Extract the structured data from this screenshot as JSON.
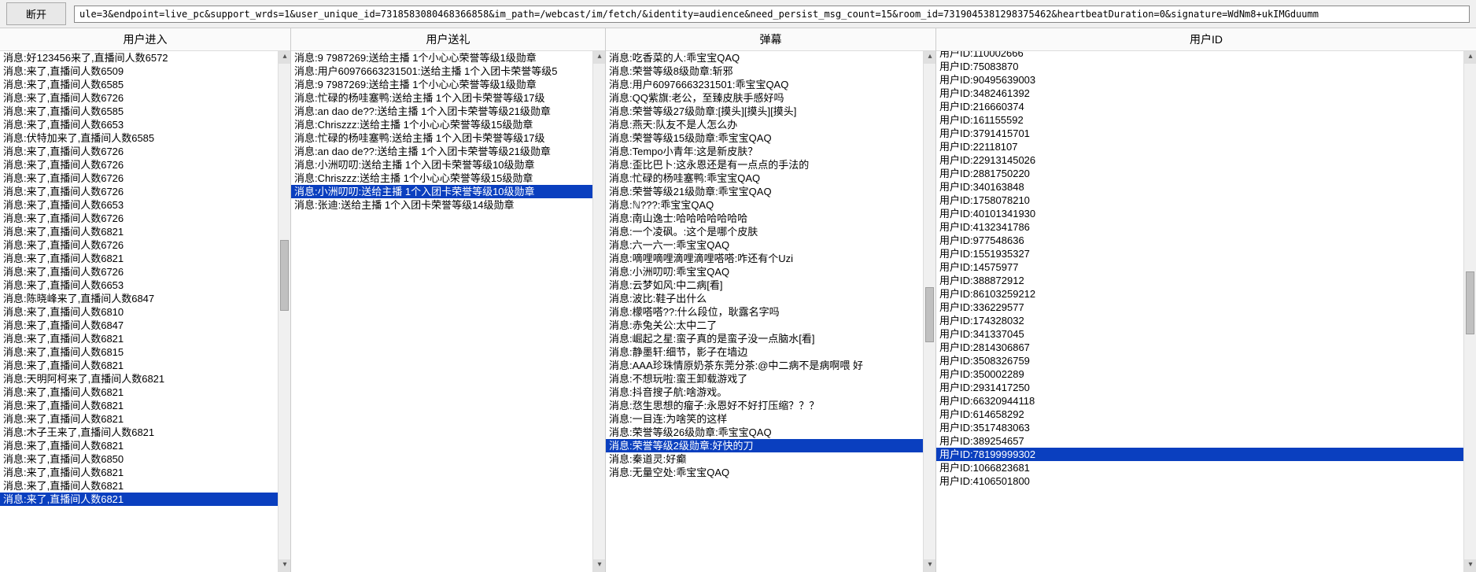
{
  "toolbar": {
    "disconnect_label": "断开",
    "url_value": "ule=3&endpoint=live_pc&support_wrds=1&user_unique_id=7318583080468366858&im_path=/webcast/im/fetch/&identity=audience&need_persist_msg_count=15&room_id=7319045381298375462&heartbeatDuration=0&signature=WdNm8+ukIMGduumm"
  },
  "columns": {
    "enter": {
      "header": "用户进入",
      "selected_index": 33,
      "items": [
        "消息:好123456来了,直播间人数6572",
        "消息:来了,直播间人数6509",
        "消息:来了,直播间人数6585",
        "消息:来了,直播间人数6726",
        "消息:来了,直播间人数6585",
        "消息:来了,直播间人数6653",
        "消息:伏特加来了,直播间人数6585",
        "消息:来了,直播间人数6726",
        "消息:来了,直播间人数6726",
        "消息:来了,直播间人数6726",
        "消息:来了,直播间人数6726",
        "消息:来了,直播间人数6653",
        "消息:来了,直播间人数6726",
        "消息:来了,直播间人数6821",
        "消息:来了,直播间人数6726",
        "消息:来了,直播间人数6821",
        "消息:来了,直播间人数6726",
        "消息:来了,直播间人数6653",
        "消息:陈晓峰来了,直播间人数6847",
        "消息:来了,直播间人数6810",
        "消息:来了,直播间人数6847",
        "消息:来了,直播间人数6821",
        "消息:来了,直播间人数6815",
        "消息:来了,直播间人数6821",
        "消息:天明阿柯来了,直播间人数6821",
        "消息:来了,直播间人数6821",
        "消息:来了,直播间人数6821",
        "消息:来了,直播间人数6821",
        "消息:木子王来了,直播间人数6821",
        "消息:来了,直播间人数6821",
        "消息:来了,直播间人数6850",
        "消息:来了,直播间人数6821",
        "消息:来了,直播间人数6821",
        "消息:来了,直播间人数6821"
      ]
    },
    "gift": {
      "header": "用户送礼",
      "selected_index": 10,
      "items": [
        "消息:9 7987269:送给主播 1个小心心荣誉等级1级勋章",
        "消息:用户60976663231501:送给主播 1个入团卡荣誉等级5",
        "消息:9 7987269:送给主播 1个小心心荣誉等级1级勋章",
        "消息:忙碌的杨哇塞鸭:送给主播 1个入团卡荣誉等级17级",
        "消息:an dao de??:送给主播 1个入团卡荣誉等级21级勋章",
        "消息:Chriszzz:送给主播 1个小心心荣誉等级15级勋章",
        "消息:忙碌的杨哇塞鸭:送给主播 1个入团卡荣誉等级17级",
        "消息:an dao de??:送给主播 1个入团卡荣誉等级21级勋章",
        "消息:小洲叨叨:送给主播 1个入团卡荣誉等级10级勋章",
        "消息:Chriszzz:送给主播 1个小心心荣誉等级15级勋章",
        "消息:小洲叨叨:送给主播 1个入团卡荣誉等级10级勋章",
        "消息:张迪:送给主播 1个入团卡荣誉等级14级勋章"
      ]
    },
    "danmu": {
      "header": "弹幕",
      "selected_index": 29,
      "items": [
        "消息:吃香菜的人:乖宝宝QAQ",
        "消息:荣誉等级8级勋章:斩邪",
        "消息:用户60976663231501:乖宝宝QAQ",
        "消息:QQ紫旗:老公，至臻皮肤手感好吗",
        "消息:荣誉等级27级勋章:[摸头][摸头][摸头]",
        "消息:燕天:队友不是人怎么办",
        "消息:荣誉等级15级勋章:乖宝宝QAQ",
        "消息:Tempo小青年:这是新皮肤？",
        "消息:歪比巴卜:这永恩还是有一点点的手法的",
        "消息:忙碌的杨哇塞鸭:乖宝宝QAQ",
        "消息:荣誉等级21级勋章:乖宝宝QAQ",
        "消息:ℕ???:乖宝宝QAQ",
        "消息:南山逸士:哈哈哈哈哈哈哈",
        "消息:一个凌砜。:这个是哪个皮肤",
        "消息:六一六一:乖宝宝QAQ",
        "消息:嘀哩嘀哩滴哩滴哩嗒嗒:咋还有个Uzi",
        "消息:小洲叨叨:乖宝宝QAQ",
        "消息:云梦如风:中二病[看]",
        "消息:波比:鞋子出什么",
        "消息:檬嗒嗒??:什么段位，耿露名字吗",
        "消息:赤兔关公:太中二了",
        "消息:崛起之星:蛮子真的是蛮子没一点脑水[看]",
        "消息:静墨轩:细节，影子在墙边",
        "消息:AAA珍珠情原奶茶东莞分茶:@中二病不是病啊喂  好",
        "消息:不想玩啦:蛮王卸载游戏了",
        "消息:抖音搜子航:啥游戏。",
        "消息:㤵生思想的瘤子:永恩好不好打压缩？？？",
        "消息:一目连:为啥笑的这样",
        "消息:荣誉等级26级勋章:乖宝宝QAQ",
        "消息:荣誉等级2级勋章:好快的刀",
        "消息:秦道灵:好癫",
        "消息:无量空处:乖宝宝QAQ"
      ]
    },
    "uid": {
      "header": "用户ID",
      "selected_index": 30,
      "items": [
        "用户ID:110002666",
        "用户ID:75083870",
        "用户ID:90495639003",
        "用户ID:3482461392",
        "用户ID:216660374",
        "用户ID:161155592",
        "用户ID:3791415701",
        "用户ID:22118107",
        "用户ID:22913145026",
        "用户ID:2881750220",
        "用户ID:340163848",
        "用户ID:1758078210",
        "用户ID:40101341930",
        "用户ID:4132341786",
        "用户ID:977548636",
        "用户ID:1551935327",
        "用户ID:14575977",
        "用户ID:388872912",
        "用户ID:86103259212",
        "用户ID:336229577",
        "用户ID:174328032",
        "用户ID:341337045",
        "用户ID:2814306867",
        "用户ID:3508326759",
        "用户ID:350002289",
        "用户ID:2931417250",
        "用户ID:66320944118",
        "用户ID:614658292",
        "用户ID:3517483063",
        "用户ID:389254657",
        "用户ID:78199999302",
        "用户ID:1066823681",
        "用户ID:4106501800"
      ]
    }
  }
}
